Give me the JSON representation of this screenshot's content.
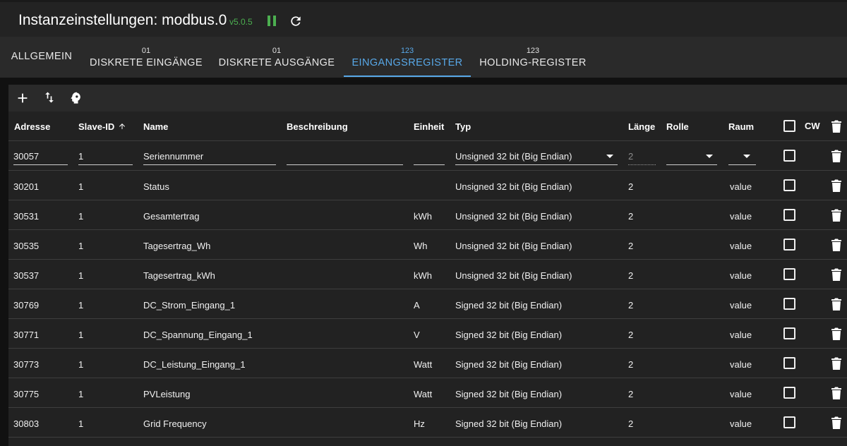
{
  "header": {
    "title": "Instanzeinstellungen: modbus.0",
    "version": "v5.0.5"
  },
  "tabs": [
    {
      "badge": "",
      "label": "ALLGEMEIN"
    },
    {
      "badge": "01",
      "label": "DISKRETE EINGÄNGE"
    },
    {
      "badge": "01",
      "label": "DISKRETE AUSGÄNGE"
    },
    {
      "badge": "123",
      "label": "EINGANGSREGISTER"
    },
    {
      "badge": "123",
      "label": "HOLDING-REGISTER"
    }
  ],
  "active_tab": "EINGANGSREGISTER",
  "toolbar": {
    "icons": [
      "add-icon",
      "swap-vertical-icon",
      "head-icon"
    ]
  },
  "columns": {
    "address": "Adresse",
    "slave_id": "Slave-ID",
    "name": "Name",
    "description": "Beschreibung",
    "unit": "Einheit",
    "type": "Typ",
    "length": "Länge",
    "role": "Rolle",
    "room": "Raum",
    "cw": "CW"
  },
  "edit_row": {
    "address": "30057",
    "slave_id": "1",
    "name": "Seriennummer",
    "description": "",
    "unit": "",
    "type": "Unsigned 32 bit (Big Endian)",
    "length": "2",
    "role": "",
    "room": ""
  },
  "rows": [
    {
      "address": "30201",
      "slave_id": "1",
      "name": "Status",
      "unit": "",
      "type": "Unsigned 32 bit (Big Endian)",
      "length": "2",
      "room": "value"
    },
    {
      "address": "30531",
      "slave_id": "1",
      "name": "Gesamtertrag",
      "unit": "kWh",
      "type": "Unsigned 32 bit (Big Endian)",
      "length": "2",
      "room": "value"
    },
    {
      "address": "30535",
      "slave_id": "1",
      "name": "Tagesertrag_Wh",
      "unit": "Wh",
      "type": "Unsigned 32 bit (Big Endian)",
      "length": "2",
      "room": "value"
    },
    {
      "address": "30537",
      "slave_id": "1",
      "name": "Tagesertrag_kWh",
      "unit": "kWh",
      "type": "Unsigned 32 bit (Big Endian)",
      "length": "2",
      "room": "value"
    },
    {
      "address": "30769",
      "slave_id": "1",
      "name": "DC_Strom_Eingang_1",
      "unit": "A",
      "type": "Signed 32 bit (Big Endian)",
      "length": "2",
      "room": "value"
    },
    {
      "address": "30771",
      "slave_id": "1",
      "name": "DC_Spannung_Eingang_1",
      "unit": "V",
      "type": "Signed 32 bit (Big Endian)",
      "length": "2",
      "room": "value"
    },
    {
      "address": "30773",
      "slave_id": "1",
      "name": "DC_Leistung_Eingang_1",
      "unit": "Watt",
      "type": "Signed 32 bit (Big Endian)",
      "length": "2",
      "room": "value"
    },
    {
      "address": "30775",
      "slave_id": "1",
      "name": "PVLeistung",
      "unit": "Watt",
      "type": "Signed 32 bit (Big Endian)",
      "length": "2",
      "room": "value"
    },
    {
      "address": "30803",
      "slave_id": "1",
      "name": "Grid Frequency",
      "unit": "Hz",
      "type": "Signed 32 bit (Big Endian)",
      "length": "2",
      "room": "value"
    }
  ],
  "colors": {
    "accent": "#58a8e8",
    "status_green": "#4caf50",
    "background": "#111111",
    "panel": "#222222"
  }
}
